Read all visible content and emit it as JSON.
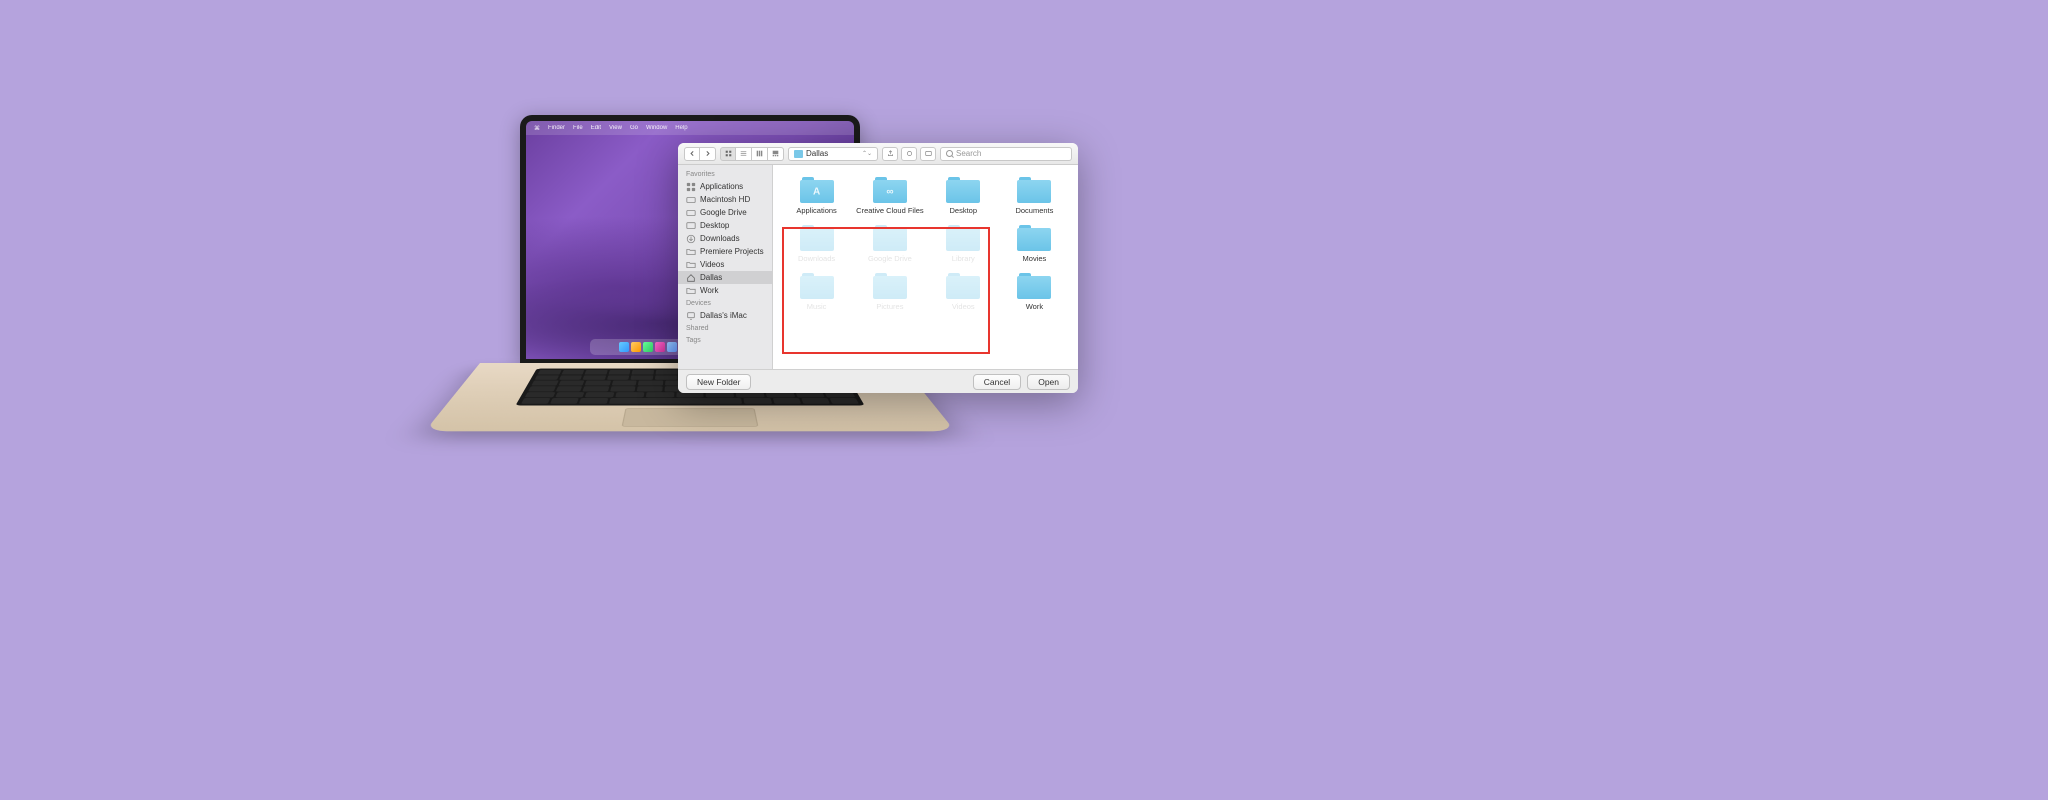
{
  "menubar": {
    "items": [
      "Finder",
      "File",
      "Edit",
      "View",
      "Go",
      "Window",
      "Help"
    ]
  },
  "dialog": {
    "location": "Dallas",
    "search_placeholder": "Search",
    "sidebar": {
      "sections": [
        {
          "title": "Favorites",
          "items": [
            {
              "icon": "apps",
              "label": "Applications"
            },
            {
              "icon": "disk",
              "label": "Macintosh HD"
            },
            {
              "icon": "disk",
              "label": "Google Drive"
            },
            {
              "icon": "desktop",
              "label": "Desktop"
            },
            {
              "icon": "downloads",
              "label": "Downloads"
            },
            {
              "icon": "folder",
              "label": "Premiere Projects"
            },
            {
              "icon": "folder",
              "label": "Videos"
            },
            {
              "icon": "home",
              "label": "Dallas",
              "selected": true
            },
            {
              "icon": "folder",
              "label": "Work"
            }
          ]
        },
        {
          "title": "Devices",
          "items": [
            {
              "icon": "computer",
              "label": "Dallas's iMac"
            }
          ]
        },
        {
          "title": "Shared",
          "items": []
        },
        {
          "title": "Tags",
          "items": []
        }
      ]
    },
    "folders": [
      {
        "label": "Applications",
        "glyph": "A",
        "hidden": false
      },
      {
        "label": "Creative Cloud Files",
        "glyph": "∞",
        "hidden": false
      },
      {
        "label": "Desktop",
        "glyph": "",
        "hidden": false
      },
      {
        "label": "Documents",
        "glyph": "",
        "hidden": false
      },
      {
        "label": "Downloads",
        "glyph": "",
        "hidden": true
      },
      {
        "label": "Google Drive",
        "glyph": "",
        "hidden": true
      },
      {
        "label": "Library",
        "glyph": "",
        "hidden": true
      },
      {
        "label": "Movies",
        "glyph": "",
        "hidden": false
      },
      {
        "label": "Music",
        "glyph": "",
        "hidden": true
      },
      {
        "label": "Pictures",
        "glyph": "",
        "hidden": true
      },
      {
        "label": "Videos",
        "glyph": "",
        "hidden": true
      },
      {
        "label": "Work",
        "glyph": "",
        "hidden": false
      }
    ],
    "footer": {
      "new_folder": "New Folder",
      "cancel": "Cancel",
      "open": "Open"
    }
  }
}
